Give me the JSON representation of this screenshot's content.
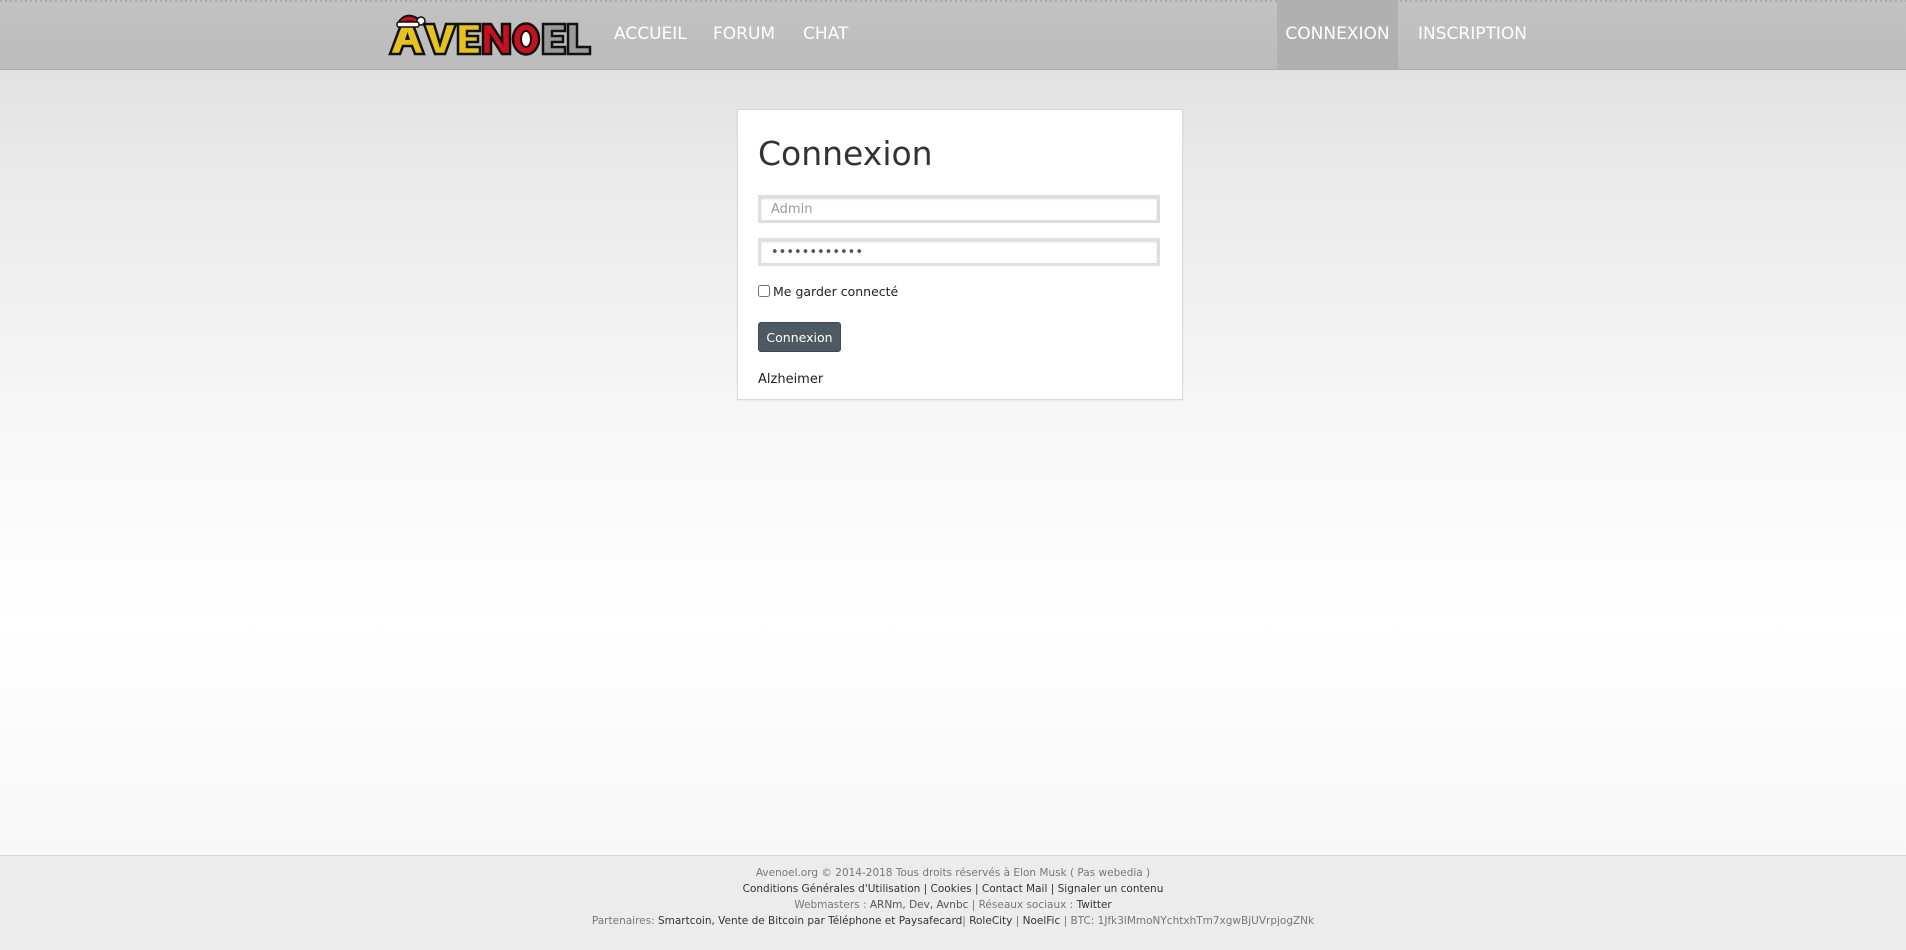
{
  "header": {
    "logo_text": "AVENOEL",
    "nav": {
      "accueil": "ACCUEIL",
      "forum": "FORUM",
      "chat": "CHAT",
      "connexion": "CONNEXION",
      "inscription": "INSCRIPTION"
    }
  },
  "login": {
    "title": "Connexion",
    "username_placeholder": "Admin",
    "password_value": "••••••••••••",
    "remember_label": "Me garder connecté",
    "submit_label": "Connexion",
    "forgot_label": "Alzheimer"
  },
  "footer": {
    "line1": "Avenoel.org © 2014-2018 Tous droits réservés à Elon Musk ( Pas webedia )",
    "cgu": "Conditions Générales d'Utilisation",
    "cookies": "Cookies",
    "contact": "Contact Mail",
    "report": "Signaler un contenu",
    "webmasters_prefix": "Webmasters : ",
    "webmasters_names": "ARNm, Dev, Avnbc",
    "social_prefix": " | Réseaux sociaux : ",
    "twitter": "Twitter",
    "partners_prefix": "Partenaires: ",
    "partner1": "Smartcoin, Vente de Bitcoin par Téléphone et Paysafecard",
    "partner2": "RoleCity",
    "partner3": "NoelFic",
    "btc": "BTC: 1Jfk3lMmoNYchtxhTm7xgwBjUVrpjogZNk"
  },
  "colors": {
    "topbar": "#bebebe",
    "logo_red": "#c8101e",
    "logo_yellow": "#e5c21f",
    "button": "#4f5963"
  }
}
